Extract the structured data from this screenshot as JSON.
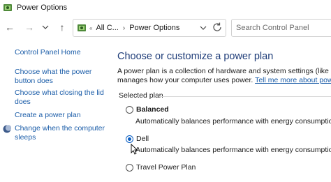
{
  "window": {
    "title": "Power Options",
    "title_icon": "power-options-icon"
  },
  "navigation": {
    "back_icon": "←",
    "forward_icon": "→",
    "recent_icon": "⌄",
    "up_icon": "↑",
    "address": {
      "separator": "«",
      "crumbs": [
        "All C...",
        "Power Options"
      ],
      "chevron": "›"
    },
    "search_placeholder": "Search Control Panel"
  },
  "sidebar": {
    "items": [
      {
        "label": "Control Panel Home"
      },
      {
        "label": "Choose what the power button does"
      },
      {
        "label": "Choose what closing the lid does"
      },
      {
        "label": "Create a power plan"
      },
      {
        "label": "Change when the computer sleeps",
        "icon": "moon-icon"
      }
    ]
  },
  "main": {
    "heading": "Choose or customize a power plan",
    "description_line1": "A power plan is a collection of hardware and system settings (like display bri",
    "description_line2_prefix": "manages how your computer uses power. ",
    "description_link": "Tell me more about power plans",
    "section_label": "Selected plan",
    "plans": [
      {
        "name": "Balanced",
        "selected": false,
        "description": "Automatically balances performance with energy consumption on cap"
      },
      {
        "name": "Dell",
        "selected": true,
        "description": "Automatically balances performance with energy consumption on cap"
      },
      {
        "name": "Travel Power Plan",
        "selected": false
      }
    ]
  },
  "colors": {
    "link": "#1a5ca8",
    "heading": "#1e3c78",
    "radio_selected": "#0a5ec2"
  }
}
